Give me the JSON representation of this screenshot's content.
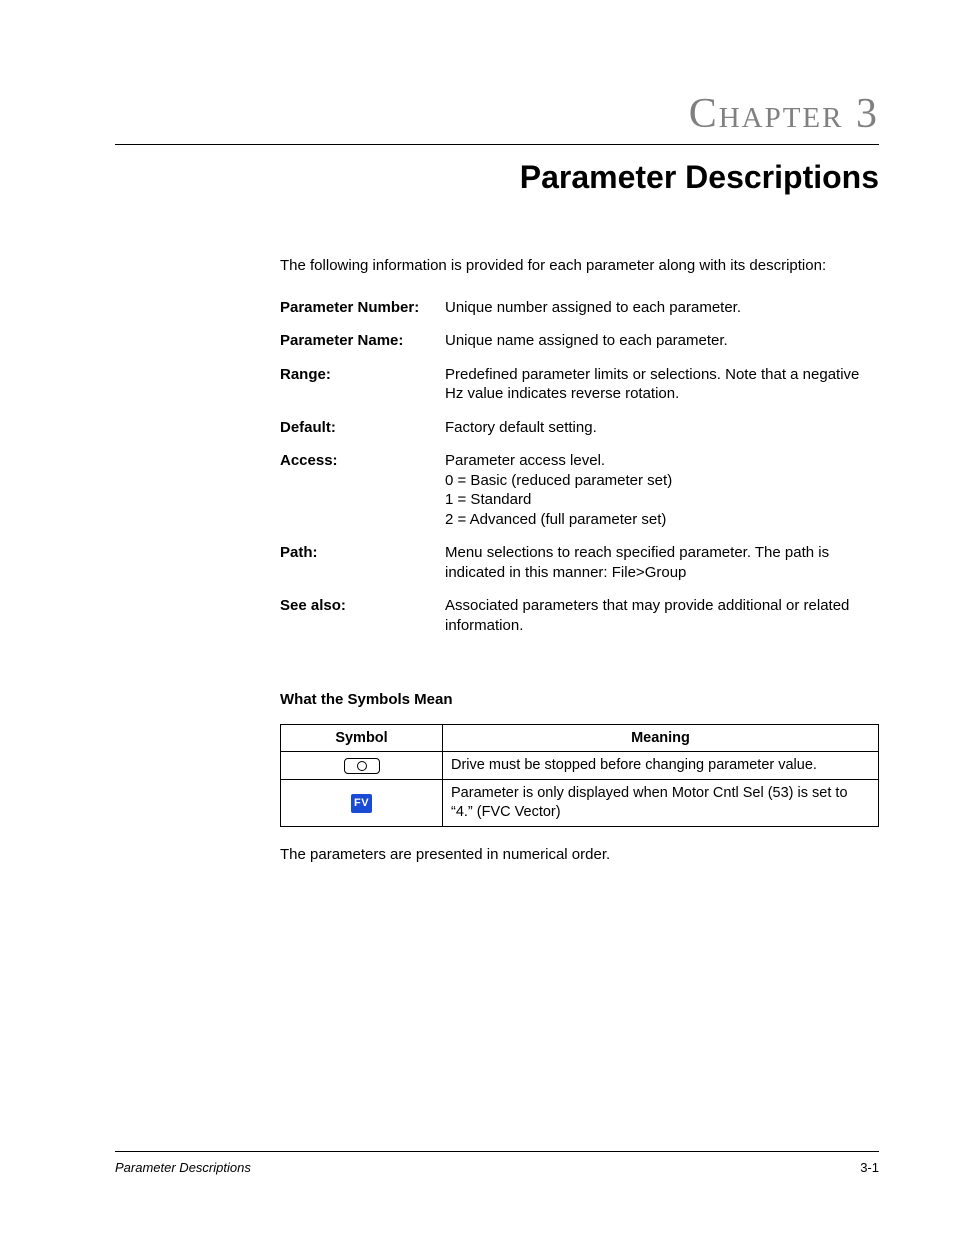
{
  "header": {
    "chapter_label": "Chapter 3",
    "title": "Parameter Descriptions"
  },
  "intro": "The following information is provided for each parameter along with its description:",
  "definitions": [
    {
      "label": "Parameter Number:",
      "value": "Unique number assigned to each parameter."
    },
    {
      "label": "Parameter Name:",
      "value": "Unique name assigned to each parameter."
    },
    {
      "label": "Range:",
      "value": "Predefined parameter limits or selections. Note that a negative Hz value indicates reverse rotation."
    },
    {
      "label": "Default:",
      "value": "Factory default setting."
    },
    {
      "label": "Access:",
      "value": "Parameter access level.\n0 = Basic (reduced parameter set)\n1 = Standard\n2 = Advanced (full parameter set)"
    },
    {
      "label": "Path:",
      "value": "Menu selections to reach specified parameter. The path is indicated in this manner: File>Group"
    },
    {
      "label": "See also:",
      "value": "Associated parameters that may provide additional or related information."
    }
  ],
  "symbols": {
    "heading": "What the Symbols Mean",
    "columns": {
      "symbol": "Symbol",
      "meaning": "Meaning"
    },
    "rows": [
      {
        "icon": "stop",
        "meaning": "Drive must be stopped before changing parameter value."
      },
      {
        "icon": "fv",
        "fv_text": "FV",
        "meaning": "Parameter is only displayed when Motor Cntl Sel (53) is set to “4.” (FVC Vector)"
      }
    ]
  },
  "closing": "The parameters are presented in numerical order.",
  "footer": {
    "left": "Parameter Descriptions",
    "right": "3-1"
  }
}
